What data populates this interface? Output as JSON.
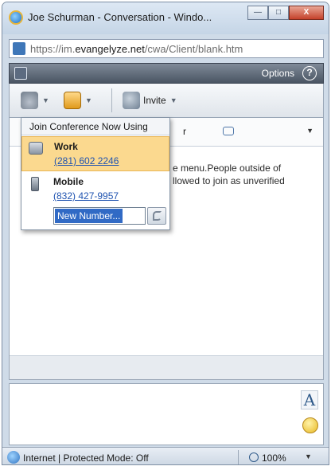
{
  "window": {
    "title": "Joe Schurman - Conversation - Windo...",
    "controls": {
      "minimize": "—",
      "maximize": "□",
      "close": "X"
    }
  },
  "address": {
    "prefix": "https://im.",
    "host": "evangelyze.net",
    "path": "/cwa/Client/blank.htm"
  },
  "app_bar": {
    "options_label": "Options",
    "help_label": "?"
  },
  "toolbar": {
    "invite_label": "Invite",
    "dropdown_arrow": "▼"
  },
  "conversation": {
    "header_letter": "r",
    "info_line_1": "e menu.People outside of",
    "info_line_2": "llowed to join as unverified"
  },
  "dropdown_menu": {
    "title": "Join Conference Now Using",
    "items": [
      {
        "name": "Work",
        "number": "(281) 602 2246",
        "icon": "deskphone-icon",
        "selected": true
      },
      {
        "name": "Mobile",
        "number": "(832) 427-9957",
        "icon": "mobile-icon",
        "selected": false
      }
    ],
    "new_number_value": "New Number..."
  },
  "compose": {
    "font_button": "A"
  },
  "status_bar": {
    "zone": "Internet | Protected Mode: Off",
    "zoom": "100%",
    "zoom_arrow": "▼"
  },
  "colors": {
    "selected_item": "#fbd98f",
    "link": "#1f53b0",
    "app_bar": "#4a5563"
  }
}
